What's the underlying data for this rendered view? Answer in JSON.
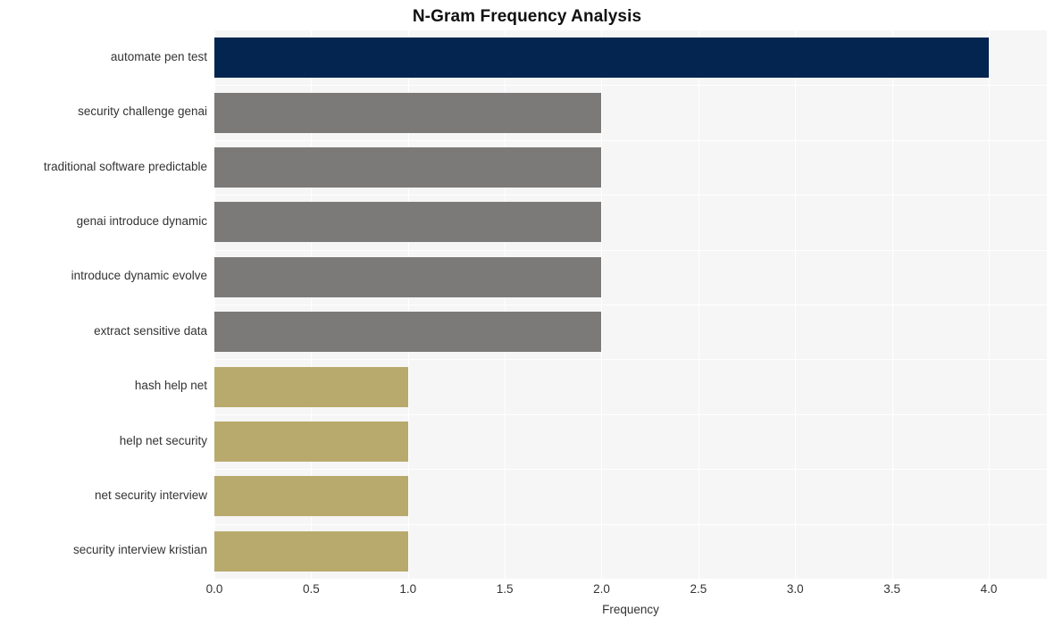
{
  "chart_data": {
    "type": "bar",
    "orientation": "horizontal",
    "title": "N-Gram Frequency Analysis",
    "xlabel": "Frequency",
    "ylabel": "",
    "categories": [
      "automate pen test",
      "security challenge genai",
      "traditional software predictable",
      "genai introduce dynamic",
      "introduce dynamic evolve",
      "extract sensitive data",
      "hash help net",
      "help net security",
      "net security interview",
      "security interview kristian"
    ],
    "values": [
      4,
      2,
      2,
      2,
      2,
      2,
      1,
      1,
      1,
      1
    ],
    "bar_colors": [
      "#04254f",
      "#7b7a78",
      "#7b7a78",
      "#7b7a78",
      "#7b7a78",
      "#7b7a78",
      "#b8aa6d",
      "#b8aa6d",
      "#b8aa6d",
      "#b8aa6d"
    ],
    "xlim": [
      0,
      4.3
    ],
    "xticks": [
      "0.0",
      "0.5",
      "1.0",
      "1.5",
      "2.0",
      "2.5",
      "3.0",
      "3.5",
      "4.0"
    ],
    "xtick_values": [
      0.0,
      0.5,
      1.0,
      1.5,
      2.0,
      2.5,
      3.0,
      3.5,
      4.0
    ],
    "grid": true,
    "legend": "none",
    "plot_background": "#f6f6f6",
    "grid_color": "#ffffff",
    "figure_background": "#ffffff"
  }
}
